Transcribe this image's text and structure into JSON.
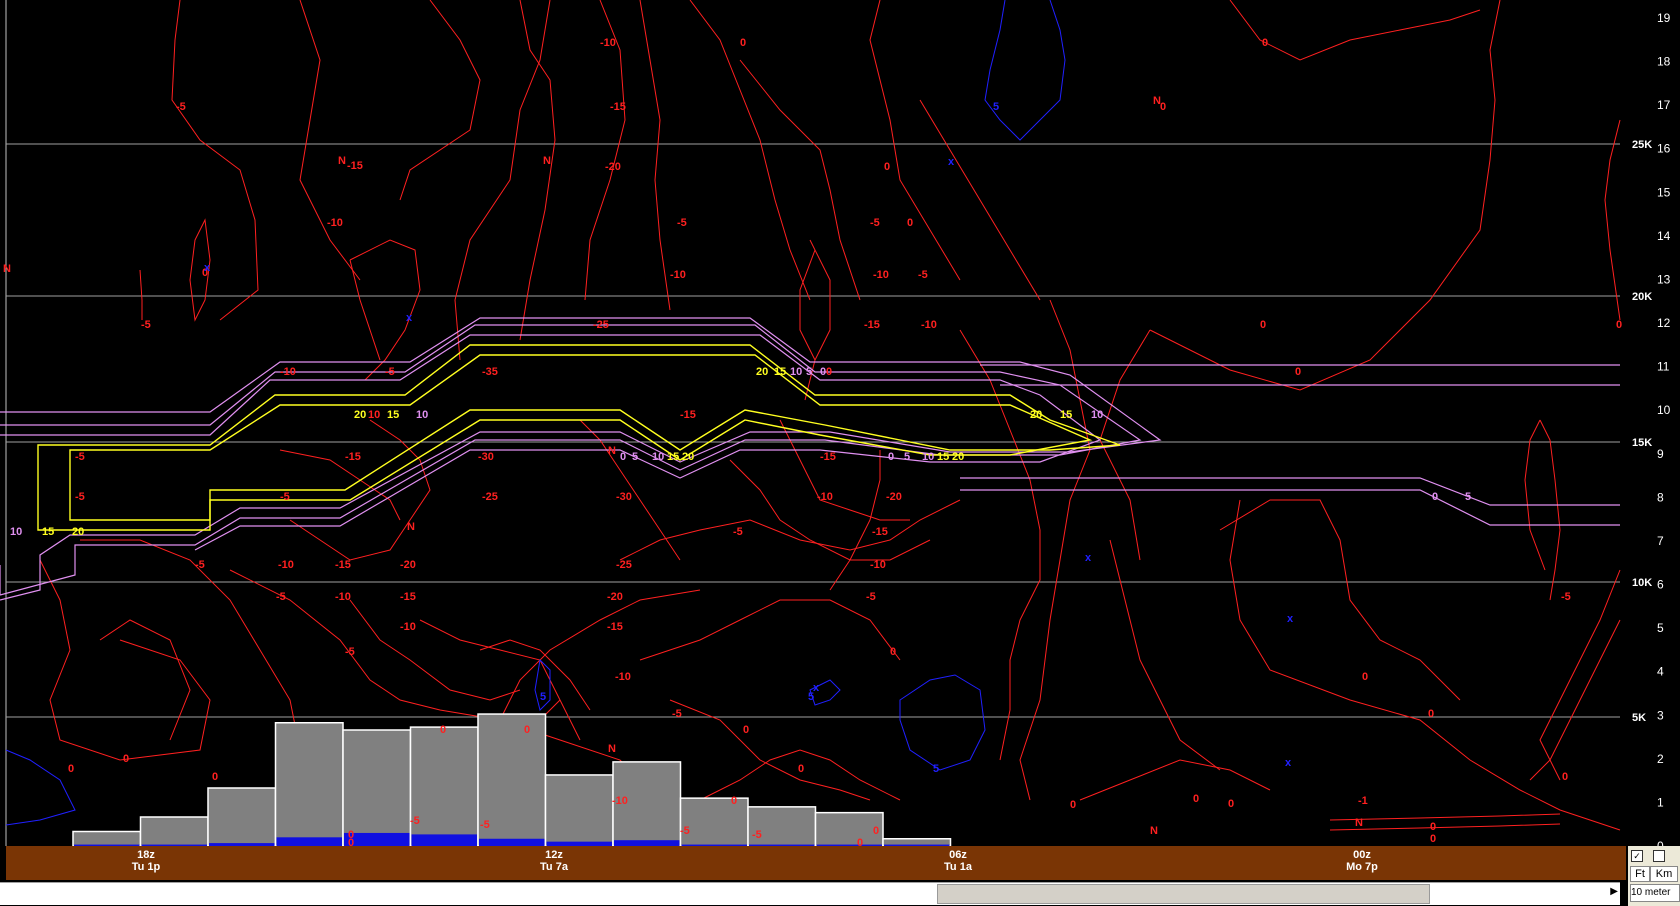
{
  "colors": {
    "background": "#000000",
    "temperature_contour": "#ff2020",
    "freezing_marker": "#2020ff",
    "icing_outer": "#e090f0",
    "icing_inner": "#ffff20",
    "grid_line": "#a0a0a0",
    "bars_fill": "#808080",
    "precip_fill": "#1010e0",
    "time_axis_bg": "#7a3505"
  },
  "altitude_axis": {
    "kilofeet_labels": [
      "19",
      "18",
      "17",
      "16",
      "15",
      "14",
      "13",
      "12",
      "11",
      "10",
      "9",
      "8",
      "7",
      "6",
      "5",
      "4",
      "3",
      "2",
      "1",
      "0"
    ],
    "feet_markers": [
      "25K",
      "20K",
      "15K",
      "10K",
      "5K"
    ]
  },
  "time_axis": {
    "ticks": [
      {
        "utc": "18z",
        "local": "Tu 1p"
      },
      {
        "utc": "12z",
        "local": "Tu 7a"
      },
      {
        "utc": "06z",
        "local": "Tu 1a"
      },
      {
        "utc": "00z",
        "local": "Mo 7p"
      }
    ]
  },
  "contour_labels": {
    "temperature": [
      "-5",
      "-15",
      "-10",
      "0",
      "-5",
      "-10",
      "-15",
      "-20",
      "-25",
      "-30",
      "-35",
      "0",
      "N",
      "X"
    ],
    "icing_yellow": [
      "20",
      "15",
      "10"
    ],
    "icing_pink": [
      "0",
      "5",
      "10",
      "15",
      "20"
    ]
  },
  "bars": {
    "values": [
      1,
      2,
      4,
      8.5,
      8,
      8.2,
      9.1,
      4.9,
      5.8,
      3.3,
      2.7,
      2.3,
      0.5
    ],
    "precip_values": [
      0.1,
      0.1,
      0.2,
      0.6,
      0.9,
      0.8,
      0.5,
      0.3,
      0.4,
      0.1,
      0.1,
      0.1,
      0.1
    ]
  },
  "units": {
    "ft_checkbox": "✓",
    "ft_label": "Ft",
    "km_label": "Km",
    "selector_value": "10 meter"
  }
}
